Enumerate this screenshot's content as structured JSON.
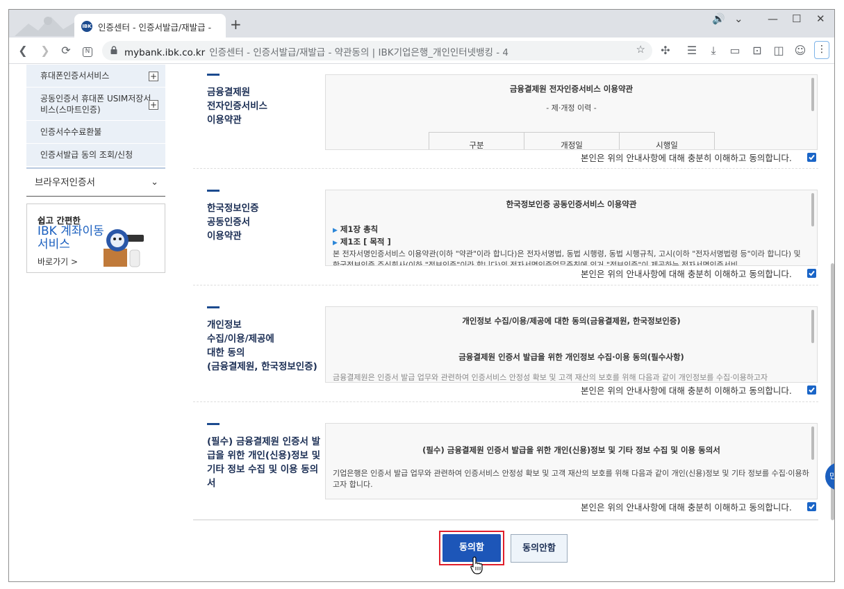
{
  "browser": {
    "tab_title": "인증센터 - 인증서발급/재발급 -",
    "tab_favicon": "IBK",
    "new_tab": "+",
    "url_host": "mybank.ibk.co.kr",
    "url_rest": "인증센터 - 인증서발급/재발급 - 약관동의 | IBK기업은행_개인인터넷뱅킹 - 4",
    "menu_icon": "⋮",
    "icons": [
      "back-icon",
      "forward-icon",
      "reload-icon",
      "reader-icon",
      "lock-icon",
      "bookmark-star-icon",
      "extensions-icon",
      "reading-list-icon",
      "download-icon",
      "cast-icon",
      "screenshot-icon",
      "sidebar-icon",
      "profile-icon",
      "menu-icon"
    ]
  },
  "sidebar": {
    "items": [
      {
        "label": "휴대폰인증서서비스",
        "expand": "+"
      },
      {
        "label": "공동인증서 휴대폰 USIM저장서비스(스마트인증)",
        "expand": "+"
      },
      {
        "label": "인증서수수료환불",
        "expand": ""
      },
      {
        "label": "인증서발급 동의 조회/신청",
        "expand": ""
      }
    ],
    "browser_cert": "브라우저인증서",
    "banner": {
      "line1": "쉽고 간편한",
      "line2": "IBK 계좌이동 서비스",
      "link": "바로가기 >"
    }
  },
  "sections": [
    {
      "label": "금융결제원\n전자인증서비스\n이용약관",
      "box_title": "금융결제원 전자인증서비스 이용약관",
      "box_sub": "- 제·개정 이력 -",
      "table_headers": [
        "구분",
        "개정일",
        "시행일"
      ],
      "agree_text": "본인은 위의 안내사항에 대해 충분히 이해하고 동의합니다."
    },
    {
      "label": "한국정보인증\n공동인증서\n이용약관",
      "box_title": "한국정보인증 공동인증서비스 이용약관",
      "chapter": "제1장 총칙",
      "article": "제1조 [ 목적 ]",
      "body": "본 전자서명인증서비스 이용약관(이하 \"약관\"이라 합니다)은 전자서명법, 동법 시행령, 동법 시행규칙, 고시(이하 \"전자서명법령 등\"이라 합니다) 및 한국정보인증 주식회사(이하 \"정보인증\"이라 합니다)의 전자서명인증업무준칙에 의거 \"정보인증\"이 제공하는 전자서명인증서비",
      "agree_text": "본인은 위의 안내사항에 대해 충분히 이해하고 동의합니다."
    },
    {
      "label": "개인정보\n수집/이용/제공에\n대한 동의\n(금융결제원, 한국정보인증)",
      "box_title": "개인정보 수집/이용/제공에 대한 동의(금융결제원, 한국정보인증)",
      "box_sub": "금융결제원 인증서 발급을 위한 개인정보 수집·이용 동의(필수사항)",
      "body": "금융결제원은 인증서 발급 업무와 관련하여 인증서비스 안정성 확보 및 고객 재산의 보호를 위해 다음과 같이 개인정보를 수집·이용하고자",
      "agree_text": "본인은 위의 안내사항에 대해 충분히 이해하고 동의합니다."
    },
    {
      "label": "(필수) 금융결제원 인증서 발\n급을 위한 개인(신용)정보 및\n기타 정보 수집 및 이용 동의\n서",
      "box_title": "(필수) 금융결제원 인증서 발급을 위한 개인(신용)정보 및 기타 정보 수집 및 이용 동의서",
      "body": "기업은행은 인증서 발급 업무와 관련하여 인증서비스 안정성 확보 및 고객 재산의 보호를 위해 다음과 같이 개인(신용)정보 및 기타 정보를 수집·이용하고자 합니다.",
      "agree_text": "본인은 위의 안내사항에 대해 충분히 이해하고 동의합니다."
    }
  ],
  "buttons": {
    "agree": "동의함",
    "disagree": "동의안함"
  },
  "side_tab": "민",
  "colors": {
    "accent": "#1d56b8",
    "highlight": "#e01e2b",
    "nav_bg": "#eaf0f7"
  }
}
